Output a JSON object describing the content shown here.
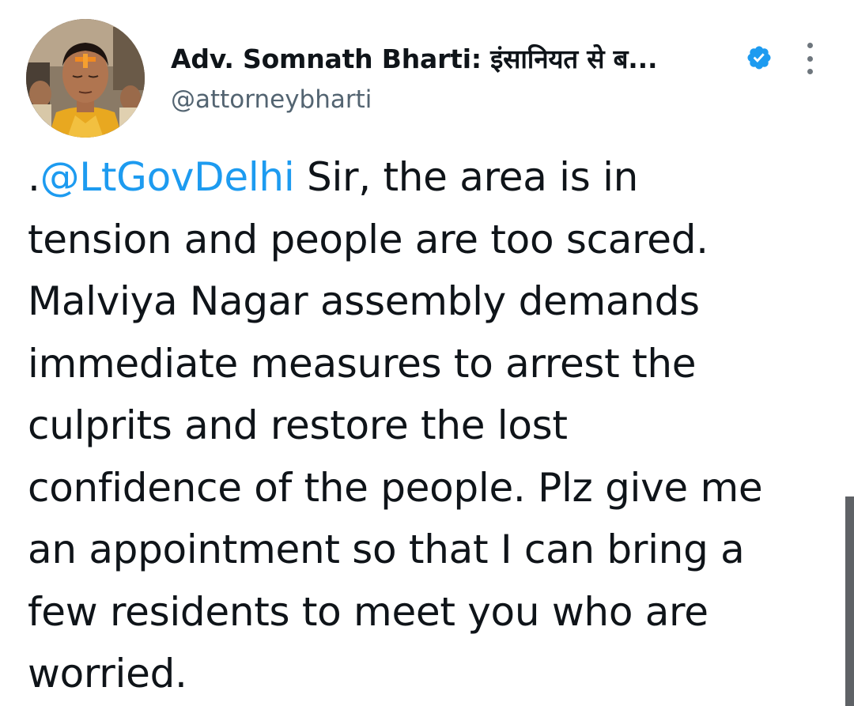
{
  "author": {
    "display_name": "Adv. Somnath Bharti: इंसानियत से ब...",
    "handle": "@attorneybharti",
    "verified": true
  },
  "icons": {
    "verified": "verified-badge-icon",
    "more": "more-options-icon"
  },
  "tweet": {
    "prefix": ".",
    "mention": "@LtGovDelhi",
    "lines": [
      " Sir, the area is in",
      "tension and people are too scared.",
      "Malviya Nagar assembly demands",
      "immediate measures to arrest the",
      "culprits and restore the lost",
      "confidence of the people. Plz give me",
      "an appointment so that I can bring a",
      "few residents to meet you who are",
      "worried."
    ]
  },
  "colors": {
    "mention": "#1d9bf0",
    "verified": "#1d9bf0",
    "text": "#0f1419",
    "secondary": "#536471"
  }
}
